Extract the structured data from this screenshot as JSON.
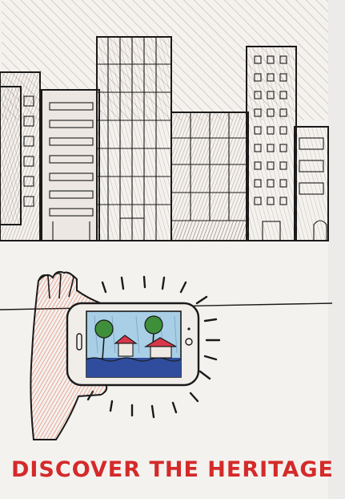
{
  "caption": "DISCOVER THE HERITAGE",
  "colors": {
    "paper": "#f4f2ef",
    "ink": "#1a1a1a",
    "hatch": "#8a6a5a",
    "accent_red": "#d42a2a",
    "sky": "#9fc8e3",
    "water": "#2f4d9c",
    "tree": "#3f8f3a",
    "roof": "#d8374a"
  },
  "icons": [
    "hand-icon",
    "smartphone-icon",
    "tree-icon",
    "house-icon"
  ]
}
